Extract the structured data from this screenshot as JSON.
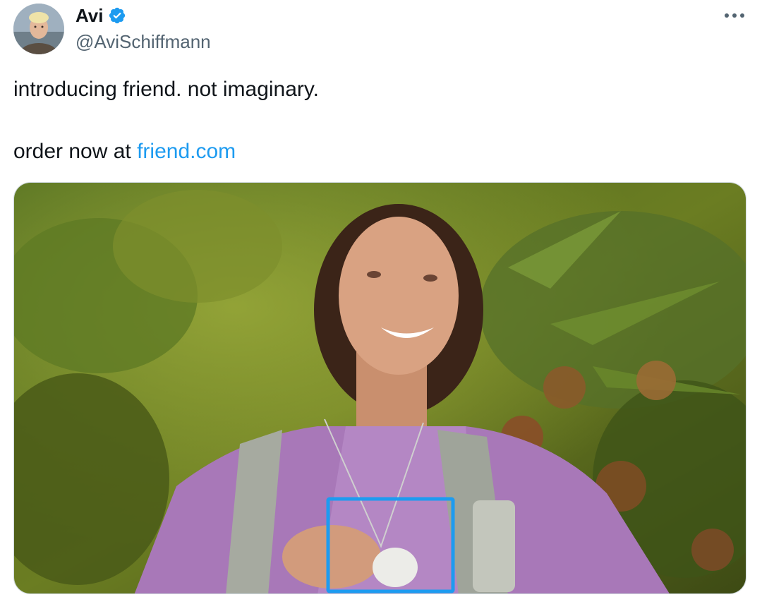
{
  "author": {
    "display_name": "Avi",
    "handle": "@AviSchiffmann",
    "verified": true,
    "avatar_icon": "user-avatar-photo",
    "verified_icon": "verified-badge-icon"
  },
  "menu": {
    "more_icon": "more-options-icon"
  },
  "tweet": {
    "line1": "introducing friend. not imaginary.",
    "line2_prefix": "order now at ",
    "link_text": "friend.com"
  },
  "media": {
    "highlight_color": "#1d9bf0"
  },
  "colors": {
    "accent": "#1d9bf0",
    "text": "#0f1419",
    "secondary_text": "#536471"
  }
}
